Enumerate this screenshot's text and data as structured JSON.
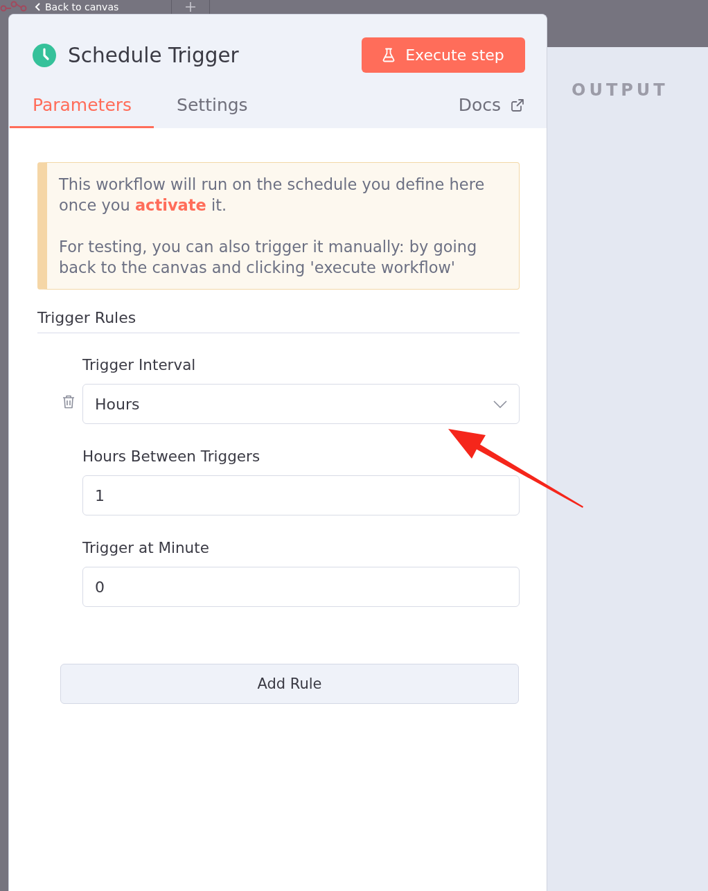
{
  "top_bar": {
    "back_button": "Back to canvas"
  },
  "node_panel": {
    "title": "Schedule Trigger",
    "execute_button": "Execute step",
    "tabs": [
      {
        "label": "Parameters",
        "selected": true
      },
      {
        "label": "Settings",
        "selected": false
      }
    ],
    "docs_link": "Docs",
    "notice": {
      "paragraphs": [
        "This workflow will run on the schedule you define here once you **activate** it.",
        "For testing, you can also trigger it manually: by going back to the canvas and clicking 'execute workflow'"
      ]
    },
    "section_title": "Trigger Rules",
    "rules": [
      {
        "fields": [
          {
            "kind": "select",
            "label": "Trigger Interval",
            "value": "Hours"
          },
          {
            "kind": "number",
            "label": "Hours Between Triggers",
            "value": "1"
          },
          {
            "kind": "number",
            "label": "Trigger at Minute",
            "value": "0"
          }
        ]
      }
    ],
    "add_rule_button": "Add Rule"
  },
  "output_panel": {
    "title": "OUTPUT"
  }
}
